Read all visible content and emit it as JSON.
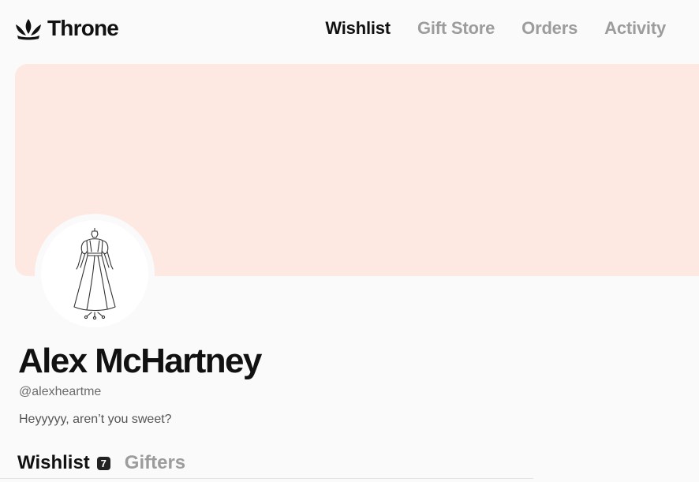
{
  "brand": {
    "name": "Throne",
    "icon": "crown-icon"
  },
  "nav": {
    "items": [
      {
        "label": "Wishlist",
        "active": true
      },
      {
        "label": "Gift Store",
        "active": false
      },
      {
        "label": "Orders",
        "active": false
      },
      {
        "label": "Activity",
        "active": false
      }
    ]
  },
  "banner": {
    "color": "#fde9e2"
  },
  "profile": {
    "avatar_icon": "dress-illustration",
    "name": "Alex McHartney",
    "handle": "@alexheartme",
    "bio": "Heyyyyy, aren’t you sweet?"
  },
  "tabs": [
    {
      "label": "Wishlist",
      "count": "7",
      "active": true
    },
    {
      "label": "Gifters",
      "active": false
    }
  ],
  "colors": {
    "accent_text": "#111111",
    "muted_text": "#9c9c9c",
    "banner": "#fde9e2"
  }
}
